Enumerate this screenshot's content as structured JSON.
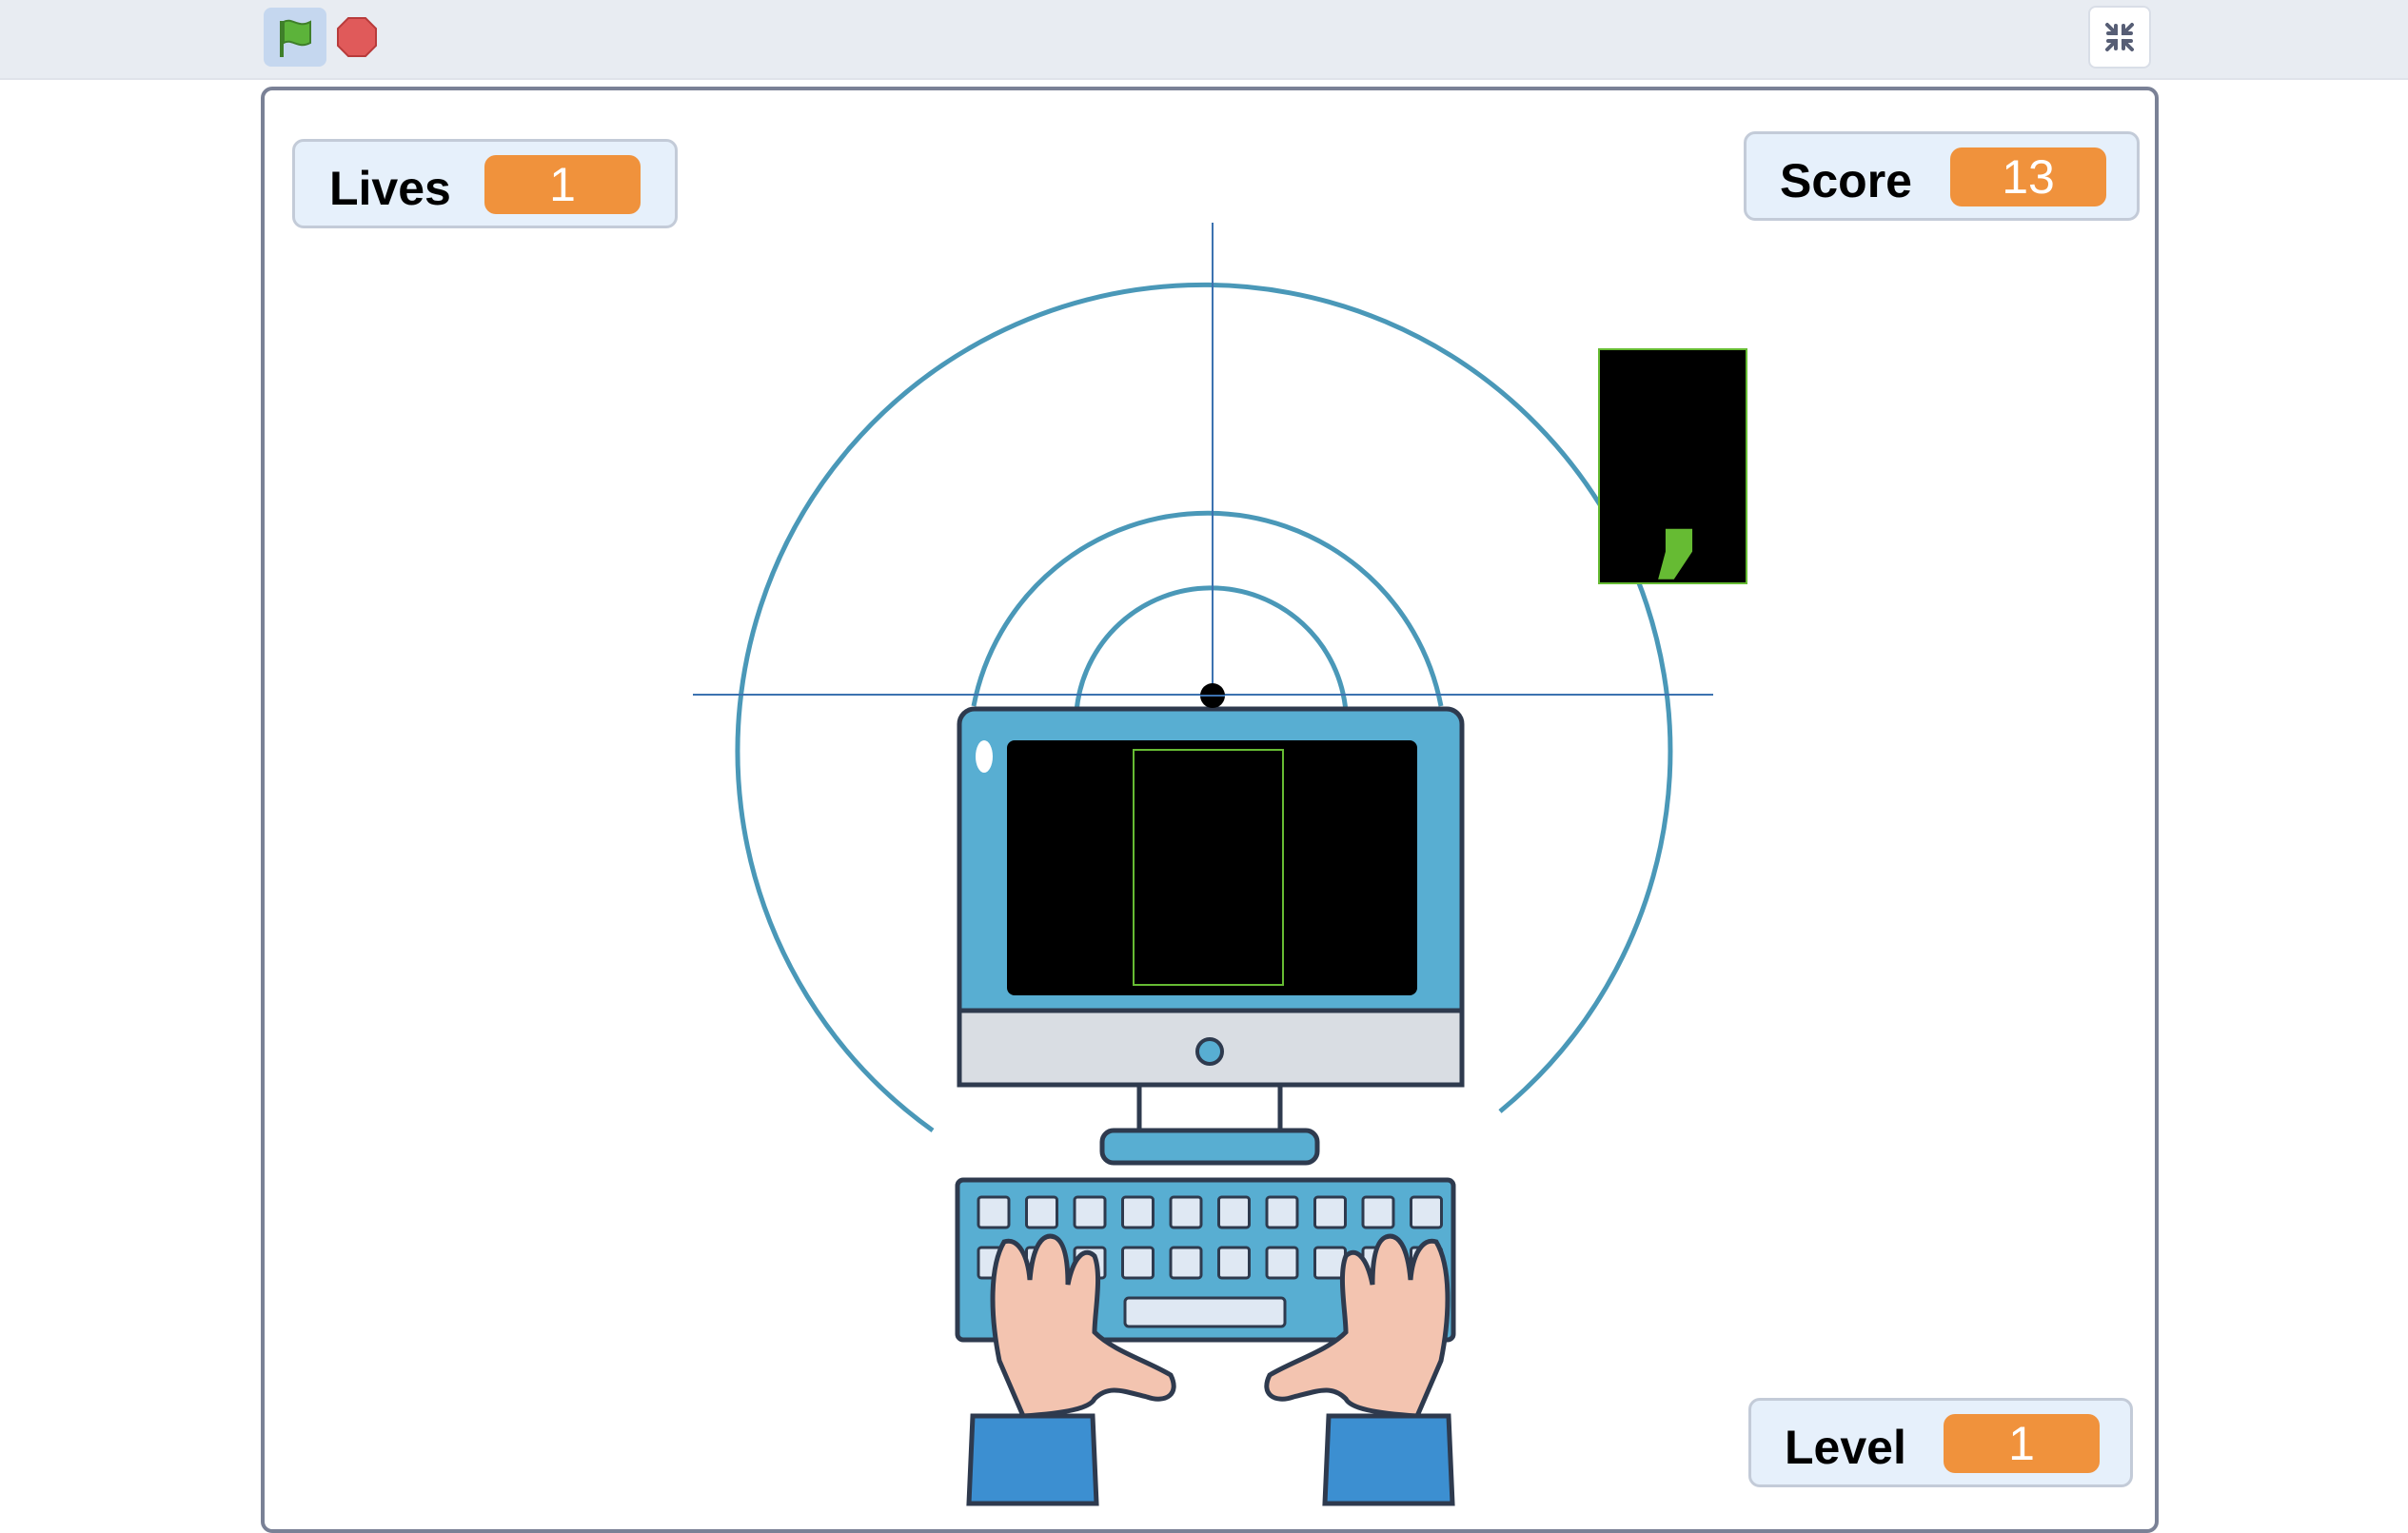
{
  "toolbar": {
    "green_flag_icon": "green-flag-icon",
    "stop_icon": "stop-sign-icon",
    "unfullscreen_icon": "exit-fullscreen-icon"
  },
  "stage": {
    "monitors": {
      "lives": {
        "label": "Lives",
        "value": "1"
      },
      "score": {
        "label": "Score",
        "value": "13"
      },
      "level": {
        "label": "Level",
        "value": "1"
      }
    },
    "falling_character": ",",
    "colors": {
      "monitor_value_bg": "#f0923c",
      "monitor_bg": "#e6f0fb",
      "target_rings": "#4a98b8",
      "crosshair": "#3c72b0",
      "glyph_green": "#66bb33",
      "monitor_screen": "#000000"
    }
  }
}
